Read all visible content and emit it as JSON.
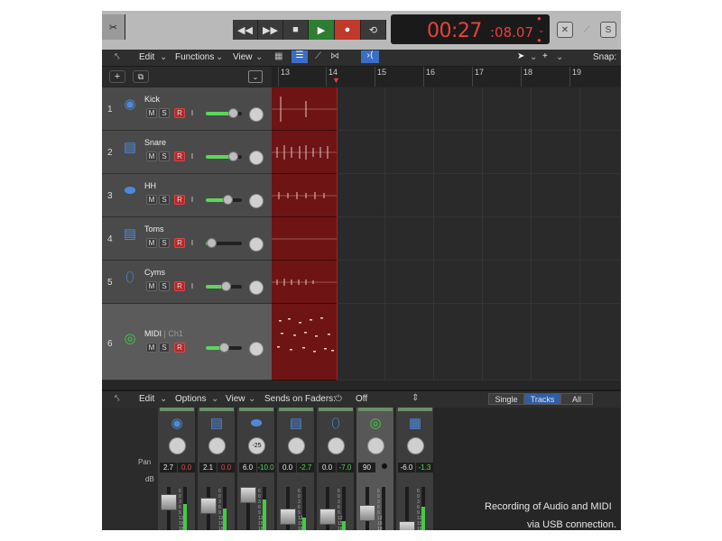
{
  "transport": {
    "time_main": "00:27",
    "time_frac": ":08.07",
    "rewind_icon": "rewind-icon",
    "forward_icon": "fast-forward-icon",
    "stop_icon": "stop-icon",
    "play_icon": "play-icon",
    "record_icon": "record-icon",
    "cycle_icon": "cycle-icon"
  },
  "toolbar": {
    "edit": "Edit",
    "functions": "Functions",
    "view": "View",
    "snap": "Snap:"
  },
  "ruler": [
    "13",
    "14",
    "15",
    "16",
    "17",
    "18",
    "19"
  ],
  "tracks": [
    {
      "num": "1",
      "name": "Kick",
      "sub": "",
      "m": "M",
      "s": "S",
      "r": "R",
      "i": "I"
    },
    {
      "num": "2",
      "name": "Snare",
      "sub": "",
      "m": "M",
      "s": "S",
      "r": "R",
      "i": "I"
    },
    {
      "num": "3",
      "name": "HH",
      "sub": "",
      "m": "M",
      "s": "S",
      "r": "R",
      "i": "I"
    },
    {
      "num": "4",
      "name": "Toms",
      "sub": "",
      "m": "M",
      "s": "S",
      "r": "R",
      "i": "I"
    },
    {
      "num": "5",
      "name": "Cyms",
      "sub": "",
      "m": "M",
      "s": "S",
      "r": "R",
      "i": "I"
    },
    {
      "num": "6",
      "name": "MIDI",
      "sub": "| Ch1",
      "m": "M",
      "s": "S",
      "r": "R",
      "i": ""
    }
  ],
  "mixer_bar": {
    "edit": "Edit",
    "options": "Options",
    "view": "View",
    "sends": "Sends on Faders:",
    "off": "Off",
    "single": "Single",
    "tracks": "Tracks",
    "all": "All"
  },
  "mixer": {
    "pan_label": "Pan",
    "db_label": "dB",
    "strips": [
      {
        "pan": "",
        "vol": "2.7",
        "peak": "0.0",
        "peak_color": "#e04a4a"
      },
      {
        "pan": "",
        "vol": "2.1",
        "peak": "0.0",
        "peak_color": "#e04a4a"
      },
      {
        "pan": "-25",
        "vol": "6.0",
        "peak": "-10.0",
        "peak_color": "#55d655"
      },
      {
        "pan": "",
        "vol": "0.0",
        "peak": "-2.7",
        "peak_color": "#55d655"
      },
      {
        "pan": "",
        "vol": "0.0",
        "peak": "-7.0",
        "peak_color": "#55d655"
      },
      {
        "pan": "",
        "vol": "90",
        "peak": "",
        "peak_color": "#55d655"
      },
      {
        "pan": "",
        "vol": "-6.0",
        "peak": "-1.3",
        "peak_color": "#55d655"
      }
    ],
    "scale": [
      "6",
      "0",
      "3",
      "6",
      "9",
      "12",
      "15",
      "18"
    ]
  },
  "caption": {
    "line1": "Recording of Audio and MIDI",
    "line2": "via USB connection."
  },
  "colors": {
    "record": "#c0392b",
    "play": "#2e7d32",
    "region": "#6e1414",
    "lcd_text": "#e8413a"
  }
}
